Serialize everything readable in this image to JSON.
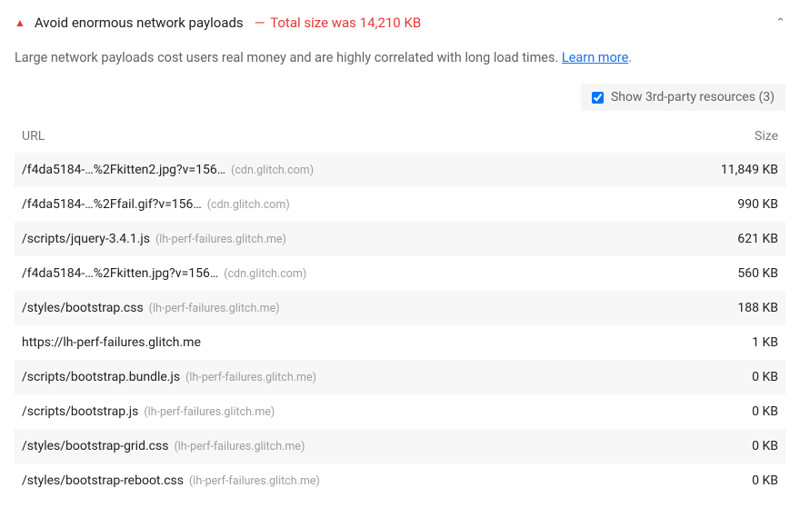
{
  "audit": {
    "title": "Avoid enormous network payloads",
    "summary": "Total size was 14,210 KB",
    "description_prefix": "Large network payloads cost users real money and are highly correlated with long load times. ",
    "learn_more": "Learn more",
    "description_suffix": "."
  },
  "thirdparty": {
    "label": "Show 3rd-party resources (3)",
    "checked": true
  },
  "table": {
    "headers": {
      "url": "URL",
      "size": "Size"
    },
    "rows": [
      {
        "url": "/f4da5184-…%2Fkitten2.jpg?v=156…",
        "origin": "(cdn.glitch.com)",
        "size": "11,849 KB"
      },
      {
        "url": "/f4da5184-…%2Ffail.gif?v=156…",
        "origin": "(cdn.glitch.com)",
        "size": "990 KB"
      },
      {
        "url": "/scripts/jquery-3.4.1.js",
        "origin": "(lh-perf-failures.glitch.me)",
        "size": "621 KB"
      },
      {
        "url": "/f4da5184-…%2Fkitten.jpg?v=156…",
        "origin": "(cdn.glitch.com)",
        "size": "560 KB"
      },
      {
        "url": "/styles/bootstrap.css",
        "origin": "(lh-perf-failures.glitch.me)",
        "size": "188 KB"
      },
      {
        "url": "https://lh-perf-failures.glitch.me",
        "origin": "",
        "size": "1 KB"
      },
      {
        "url": "/scripts/bootstrap.bundle.js",
        "origin": "(lh-perf-failures.glitch.me)",
        "size": "0 KB"
      },
      {
        "url": "/scripts/bootstrap.js",
        "origin": "(lh-perf-failures.glitch.me)",
        "size": "0 KB"
      },
      {
        "url": "/styles/bootstrap-grid.css",
        "origin": "(lh-perf-failures.glitch.me)",
        "size": "0 KB"
      },
      {
        "url": "/styles/bootstrap-reboot.css",
        "origin": "(lh-perf-failures.glitch.me)",
        "size": "0 KB"
      }
    ]
  }
}
